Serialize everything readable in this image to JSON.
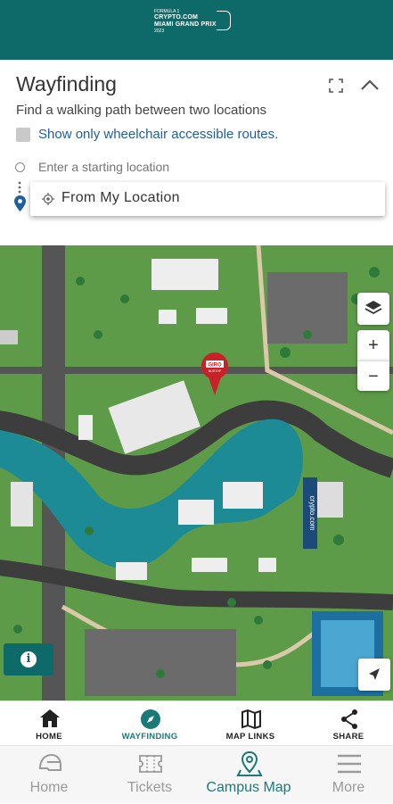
{
  "header": {
    "logo_line1": "FORMULA 1",
    "logo_line2": "CRYPTO.COM",
    "logo_line3": "MIAMI GRAND PRIX",
    "logo_line4": "2023",
    "brand_color": "#0e6a68"
  },
  "panel": {
    "title": "Wayfinding",
    "subtitle": "Find a walking path between two locations",
    "wheelchair_label": "Show only wheelchair accessible routes.",
    "start_placeholder": "Enter a starting location",
    "dropdown_option": "From My Location",
    "expand_icon": "expand-icon",
    "collapse_icon": "chevron-up-icon"
  },
  "map": {
    "marker_text": "GIRO",
    "marker_subtext": "BUSTOP",
    "building_sign": "crypto.com",
    "info_label": "i",
    "zoom_in": "+",
    "zoom_out": "−"
  },
  "subnav": {
    "items": [
      {
        "label": "HOME",
        "icon": "home-icon"
      },
      {
        "label": "WAYFINDING",
        "icon": "compass-icon"
      },
      {
        "label": "MAP LINKS",
        "icon": "map-icon"
      },
      {
        "label": "SHARE",
        "icon": "share-icon"
      }
    ],
    "active_color": "#1a7a78"
  },
  "bottomnav": {
    "items": [
      {
        "label": "Home",
        "icon": "helmet-icon"
      },
      {
        "label": "Tickets",
        "icon": "ticket-icon"
      },
      {
        "label": "Campus Map",
        "icon": "map-pin-icon"
      },
      {
        "label": "More",
        "icon": "menu-icon"
      }
    ]
  }
}
